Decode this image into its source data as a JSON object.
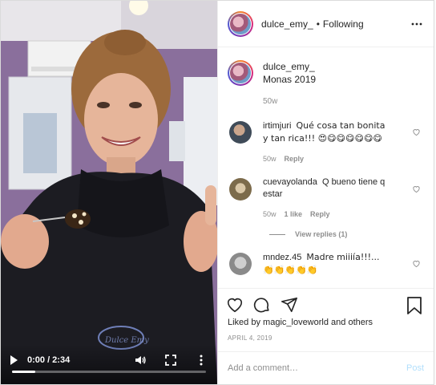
{
  "header": {
    "username": "dulce_emy_",
    "separator": "•",
    "follow_label": "Following"
  },
  "video": {
    "time": "0:00 / 2:34",
    "progress": 0.12,
    "shirt_text": "Dulce Emy"
  },
  "caption": {
    "username": "dulce_emy_",
    "text": "Monas 2019",
    "time": "50w"
  },
  "comments": [
    {
      "username": "irtimjuri",
      "text": "Qué cosa tan bonita y tan rica!!! 😍😋😋😋😋😋😋",
      "time": "50w",
      "likes": "",
      "reply": "Reply",
      "avatar_color": "#4a5a6a"
    },
    {
      "username": "cuevayolanda",
      "text": "Q bueno tiene q estar",
      "time": "50w",
      "likes": "1 like",
      "reply": "Reply",
      "avatar_color": "#8a7a5a",
      "view_replies": "View replies (1)"
    },
    {
      "username": "mndez.45",
      "text": "Madre miiiía!!!... 👏👏👏👏👏",
      "time": "",
      "likes": "",
      "reply": "",
      "avatar_color": "#9a9a9a"
    }
  ],
  "likes": {
    "prefix": "Liked by",
    "user": "magic_loveworld",
    "suffix": "and others"
  },
  "date": "APRIL 4, 2019",
  "add_comment": {
    "placeholder": "Add a comment…",
    "post_label": "Post"
  },
  "colors": {
    "post_button": "#b2dffc",
    "text": "#262626",
    "meta": "#8e8e8e"
  }
}
